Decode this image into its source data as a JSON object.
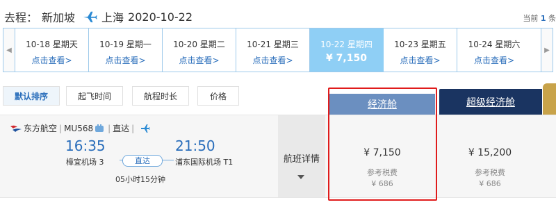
{
  "header": {
    "origin_prefix": "去程：",
    "origin": "新加坡",
    "destination": "上海",
    "date": "2020-10-22",
    "page_prefix": "当前",
    "page_num": "1",
    "page_suffix": "条"
  },
  "date_strip": [
    {
      "date": "10-18 星期天",
      "price": "点击查看>",
      "active": false
    },
    {
      "date": "10-19 星期一",
      "price": "点击查看>",
      "active": false
    },
    {
      "date": "10-20 星期二",
      "price": "点击查看>",
      "active": false
    },
    {
      "date": "10-21 星期三",
      "price": "点击查看>",
      "active": false
    },
    {
      "date": "10-22 星期四",
      "price": "¥ 7,150",
      "active": true
    },
    {
      "date": "10-23 星期五",
      "price": "点击查看>",
      "active": false
    },
    {
      "date": "10-24 星期六",
      "price": "点击查看>",
      "active": false
    }
  ],
  "sort_tabs": [
    "默认排序",
    "起飞时间",
    "航程时长",
    "价格"
  ],
  "cabins": {
    "economy": "经济舱",
    "super_economy": "超级经济舱"
  },
  "flight": {
    "airline": "东方航空",
    "flight_no": "MU568",
    "type": "直达",
    "dep_time": "16:35",
    "dep_airport": "樟宜机场 3",
    "arr_time": "21:50",
    "arr_airport": "浦东国际机场 T1",
    "direct_label": "直达",
    "duration": "05小时15分钟",
    "details_label": "航班详情",
    "economy": {
      "price": "¥ 7,150",
      "tax_label": "参考税费",
      "tax": "¥ 686"
    },
    "super_economy": {
      "price": "¥ 15,200",
      "tax_label": "参考税费",
      "tax": "¥ 686"
    }
  },
  "colors": {
    "accent_blue": "#2a6ebb",
    "active_date": "#8fcff5",
    "economy_header": "#6b8fc0",
    "super_economy_header": "#1a3461",
    "highlight_red": "#e01b1b"
  },
  "icons": {
    "title_plane": "plane-icon",
    "airline_logo": "china-eastern-logo",
    "meal": "meal-icon",
    "flight_plane": "plane-icon",
    "dropdown": "caret-down-icon"
  }
}
